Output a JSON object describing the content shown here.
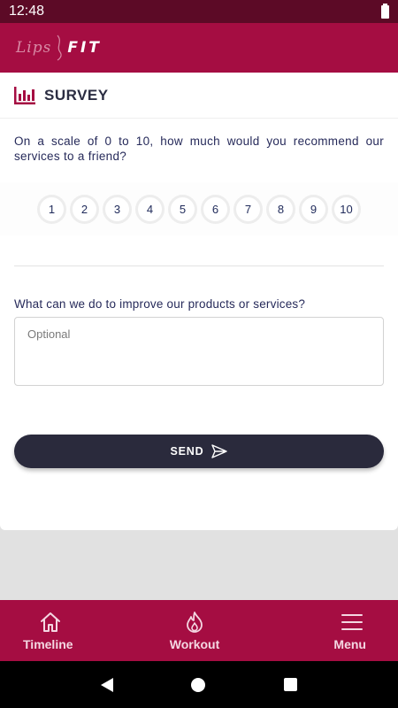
{
  "status_bar": {
    "time": "12:48",
    "battery_icon": "battery-icon"
  },
  "app": {
    "logo_script": "Lips",
    "logo_word": "FIT",
    "brand_color": "#a50d42",
    "dark_color": "#5c0a26"
  },
  "survey": {
    "title": "SURVEY",
    "icon": "bar-chart-icon",
    "question": "On a scale of 0 to 10, how much would you recommend our services to a friend?",
    "ratings": [
      "1",
      "2",
      "3",
      "4",
      "5",
      "6",
      "7",
      "8",
      "9",
      "10"
    ],
    "improve_label": "What can we do to improve our products or services?",
    "improve_placeholder": "Optional",
    "improve_value": "",
    "send_label": "SEND",
    "send_icon": "send-icon",
    "send_color": "#2a2a3c"
  },
  "bottom_nav": {
    "items": [
      {
        "label": "Timeline",
        "icon": "home-icon"
      },
      {
        "label": "Workout",
        "icon": "flame-icon"
      },
      {
        "label": "Menu",
        "icon": "hamburger-icon"
      }
    ]
  },
  "android_nav": {
    "back": "back-icon",
    "home": "home-circle-icon",
    "recent": "recents-icon"
  }
}
